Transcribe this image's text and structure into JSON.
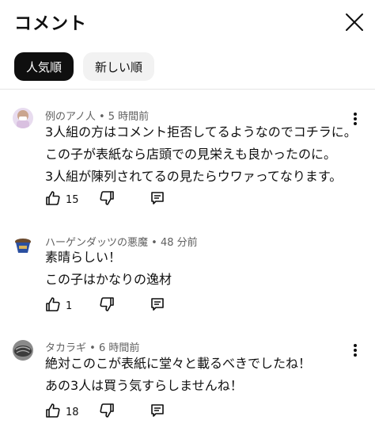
{
  "header": {
    "title": "コメント",
    "close_icon": "close-icon"
  },
  "sort": {
    "options": [
      "人気順",
      "新しい順"
    ],
    "active": "人気順"
  },
  "comments": [
    {
      "author": "例のアノ人",
      "time": "5 時間前",
      "lines": [
        "3人組の方はコメント拒否してるようなのでコチラに。",
        "この子が表紙なら店頭での見栄えも良かったのに。",
        "3人組が陳列されてるの見たらウワァってなります。"
      ],
      "likes": "15"
    },
    {
      "author": "ハーゲンダッツの悪魔",
      "time": "48 分前",
      "lines": [
        "素晴らしい！",
        "この子はかなりの逸材"
      ],
      "likes": "1"
    },
    {
      "author": "タカラギ",
      "time": "6 時間前",
      "lines": [
        "絶対このこが表紙に堂々と載るべきでしたね！",
        "あの3人は買う気すらしませんね！"
      ],
      "likes": "18"
    }
  ],
  "icons": {
    "like": "thumbs-up-icon",
    "dislike": "thumbs-down-icon",
    "reply": "reply-icon",
    "more": "more-vertical-icon"
  },
  "colors": {
    "text": "#0f0f0f",
    "meta": "#606060",
    "chip_active": "#0f0f0f",
    "chip_inactive": "#f2f2f2"
  }
}
